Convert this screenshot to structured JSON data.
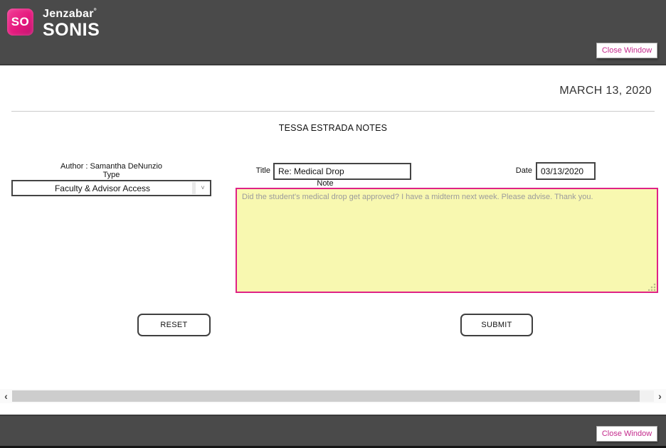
{
  "brand": {
    "logo_text": "SO",
    "name_top": "Jenzabar",
    "trademark": "®",
    "name_bottom": "SONIS"
  },
  "header": {
    "close_button": "Close Window"
  },
  "page": {
    "date_heading": "MARCH 13, 2020",
    "title": "TESSA ESTRADA NOTES"
  },
  "form": {
    "author_label": "Author : Samantha DeNunzio",
    "type_label": "Type",
    "type_value": "Faculty & Advisor Access",
    "title_label": "Title",
    "title_value": "Re: Medical Drop",
    "note_label": "Note",
    "note_value": "Did the student's medical drop get approved? I have a midterm next week. Please advise. Thank you.",
    "date_label": "Date",
    "date_value": "03/13/2020",
    "reset_button": "RESET",
    "submit_button": "SUBMIT"
  },
  "scrollbar": {
    "left_arrow": "‹",
    "right_arrow": "›"
  },
  "icons": {
    "select_chevron": "˅"
  },
  "footer": {
    "close_button": "Close Window"
  },
  "colors": {
    "header_bg": "#4a4a4a",
    "brand_pink": "#e5197d",
    "accent_pink": "#c42a8c",
    "note_bg": "#f8f8b0",
    "note_border": "#df2286"
  }
}
